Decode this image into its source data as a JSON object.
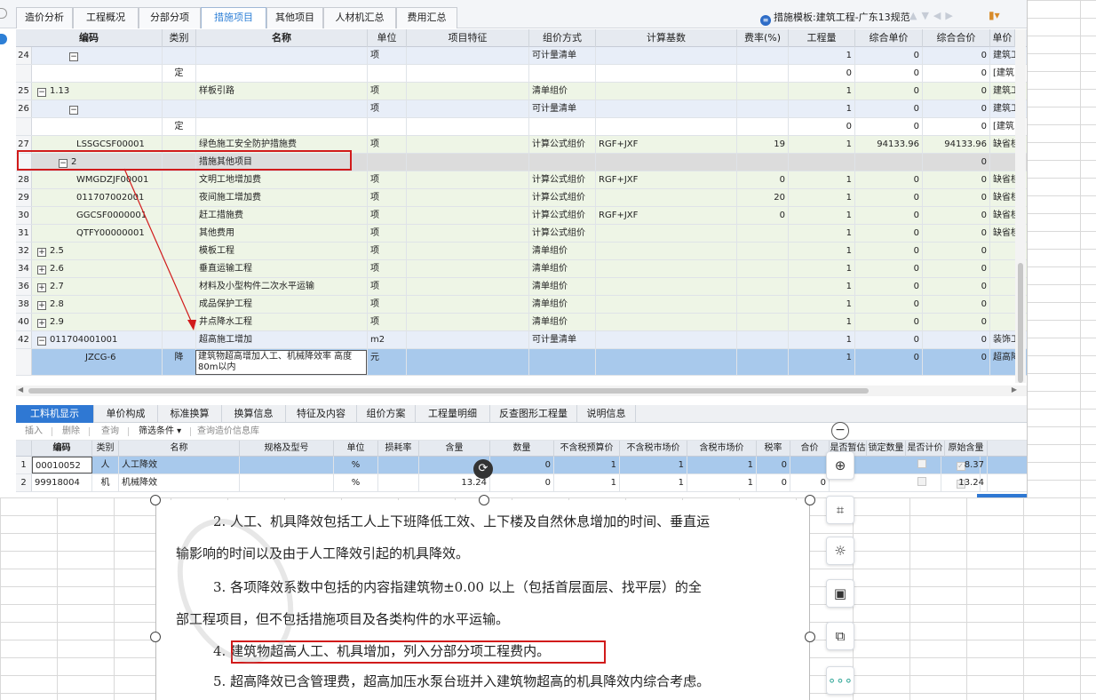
{
  "top_tabs": [
    "造价分析",
    "工程概况",
    "分部分项",
    "措施项目",
    "其他项目",
    "人材机汇总",
    "费用汇总"
  ],
  "active_tab": "措施项目",
  "template_label": "措施模板:建筑工程-广东13规范",
  "grid": {
    "headers": [
      "编码",
      "类别",
      "名称",
      "单位",
      "项目特征",
      "组价方式",
      "计算基数",
      "费率(%)",
      "工程量",
      "综合单价",
      "综合合价",
      "单价"
    ],
    "rows": [
      {
        "num": "24",
        "code": "",
        "tree": "−",
        "cat": "",
        "name": "",
        "unit": "项",
        "method": "可计量清单",
        "base": "",
        "rate": "",
        "qty": "1",
        "uprice": "0",
        "total": "0",
        "extra": "建筑工"
      },
      {
        "num": "",
        "code": "",
        "tree": "",
        "cat": "定",
        "name": "",
        "unit": "",
        "method": "",
        "base": "",
        "rate": "",
        "qty": "0",
        "uprice": "0",
        "total": "0",
        "extra": "[建筑"
      },
      {
        "num": "25",
        "code": "1.13",
        "tree": "−",
        "cat": "",
        "name": "样板引路",
        "unit": "项",
        "method": "清单组价",
        "base": "",
        "rate": "",
        "qty": "1",
        "uprice": "0",
        "total": "0",
        "extra": "建筑工"
      },
      {
        "num": "26",
        "code": "",
        "tree": "−",
        "cat": "",
        "name": "",
        "unit": "项",
        "method": "可计量清单",
        "base": "",
        "rate": "",
        "qty": "1",
        "uprice": "0",
        "total": "0",
        "extra": "建筑工"
      },
      {
        "num": "",
        "code": "",
        "tree": "",
        "cat": "定",
        "name": "",
        "unit": "",
        "method": "",
        "base": "",
        "rate": "",
        "qty": "0",
        "uprice": "0",
        "total": "0",
        "extra": "[建筑"
      },
      {
        "num": "27",
        "code": "LSSGCSF00001",
        "tree": "",
        "cat": "",
        "name": "绿色施工安全防护措施费",
        "unit": "项",
        "method": "计算公式组价",
        "base": "RGF+JXF",
        "rate": "19",
        "qty": "1",
        "uprice": "94133.96",
        "total": "94133.96",
        "extra": "缺省桂"
      },
      {
        "num": "",
        "code": "2",
        "tree": "−",
        "cat": "",
        "name": "措施其他项目",
        "unit": "",
        "method": "",
        "base": "",
        "rate": "",
        "qty": "",
        "uprice": "",
        "total": "0",
        "extra": ""
      },
      {
        "num": "28",
        "code": "WMGDZJF00001",
        "tree": "",
        "cat": "",
        "name": "文明工地增加费",
        "unit": "项",
        "method": "计算公式组价",
        "base": "RGF+JXF",
        "rate": "0",
        "qty": "1",
        "uprice": "0",
        "total": "0",
        "extra": "缺省桂"
      },
      {
        "num": "29",
        "code": "011707002001",
        "tree": "",
        "cat": "",
        "name": "夜间施工增加费",
        "unit": "项",
        "method": "计算公式组价",
        "base": "",
        "rate": "20",
        "qty": "1",
        "uprice": "0",
        "total": "0",
        "extra": "缺省桂"
      },
      {
        "num": "30",
        "code": "GGCSF0000001",
        "tree": "",
        "cat": "",
        "name": "赶工措施费",
        "unit": "项",
        "method": "计算公式组价",
        "base": "RGF+JXF",
        "rate": "0",
        "qty": "1",
        "uprice": "0",
        "total": "0",
        "extra": "缺省桂"
      },
      {
        "num": "31",
        "code": "QTFY00000001",
        "tree": "",
        "cat": "",
        "name": "其他费用",
        "unit": "项",
        "method": "计算公式组价",
        "base": "",
        "rate": "",
        "qty": "1",
        "uprice": "0",
        "total": "0",
        "extra": "缺省桂"
      },
      {
        "num": "32",
        "code": "2.5",
        "tree": "+",
        "cat": "",
        "name": "模板工程",
        "unit": "项",
        "method": "清单组价",
        "base": "",
        "rate": "",
        "qty": "1",
        "uprice": "0",
        "total": "0",
        "extra": ""
      },
      {
        "num": "34",
        "code": "2.6",
        "tree": "+",
        "cat": "",
        "name": "垂直运输工程",
        "unit": "项",
        "method": "清单组价",
        "base": "",
        "rate": "",
        "qty": "1",
        "uprice": "0",
        "total": "0",
        "extra": ""
      },
      {
        "num": "36",
        "code": "2.7",
        "tree": "+",
        "cat": "",
        "name": "材料及小型构件二次水平运输",
        "unit": "项",
        "method": "清单组价",
        "base": "",
        "rate": "",
        "qty": "1",
        "uprice": "0",
        "total": "0",
        "extra": ""
      },
      {
        "num": "38",
        "code": "2.8",
        "tree": "+",
        "cat": "",
        "name": "成品保护工程",
        "unit": "项",
        "method": "清单组价",
        "base": "",
        "rate": "",
        "qty": "1",
        "uprice": "0",
        "total": "0",
        "extra": ""
      },
      {
        "num": "40",
        "code": "2.9",
        "tree": "+",
        "cat": "",
        "name": "井点降水工程",
        "unit": "项",
        "method": "清单组价",
        "base": "",
        "rate": "",
        "qty": "1",
        "uprice": "0",
        "total": "0",
        "extra": ""
      },
      {
        "num": "42",
        "code": "011704001001",
        "tree": "−",
        "cat": "",
        "name": "超高施工增加",
        "unit": "m2",
        "method": "可计量清单",
        "base": "",
        "rate": "",
        "qty": "1",
        "uprice": "0",
        "total": "0",
        "extra": "装饰工"
      },
      {
        "num": "",
        "code": "JZCG-6",
        "tree": "",
        "cat": "降",
        "name": "建筑物超高增加人工、机械降效率 高度80m以内",
        "unit": "元",
        "method": "",
        "base": "",
        "rate": "",
        "qty": "1",
        "uprice": "0",
        "total": "0",
        "extra": "超高降"
      }
    ]
  },
  "bottom_tabs": [
    "工料机显示",
    "单价构成",
    "标准换算",
    "换算信息",
    "特征及内容",
    "组价方案",
    "工程量明细",
    "反查图形工程量",
    "说明信息"
  ],
  "bottom_toolbar": [
    "插入",
    "删除",
    "查询",
    "筛选条件",
    "查询造价信息库"
  ],
  "bottom_headers": [
    "编码",
    "类别",
    "名称",
    "规格及型号",
    "单位",
    "损耗率",
    "含量",
    "数量",
    "不含税预算价",
    "不含税市场价",
    "含税市场价",
    "税率",
    "合价",
    "是否暂估",
    "锁定数量",
    "是否计价",
    "原始含量"
  ],
  "bottom_rows": [
    {
      "num": "1",
      "code": "00010052",
      "cat": "人",
      "name": "人工降效",
      "unit": "%",
      "qty_content": "",
      "qty": "0",
      "p1": "1",
      "p2": "1",
      "p3": "1",
      "tax": "0",
      "total": "",
      "orig": "8.37"
    },
    {
      "num": "2",
      "code": "99918004",
      "cat": "机",
      "name": "机械降效",
      "unit": "%",
      "qty_content": "13.24",
      "qty": "0",
      "p1": "1",
      "p2": "1",
      "p3": "1",
      "tax": "0",
      "total": "0",
      "orig": "13.24"
    }
  ],
  "doc": {
    "p1a": "2. 人工、机具降效包括工人上下班降低工效、上下楼及自然休息增加的时间、垂直运",
    "p1b": "输影响的时间以及由于人工降效引起的机具降效。",
    "p2a": "3. 各项降效系数中包括的内容指建筑物±0.00 以上（包括首层面层、找平层）的全",
    "p2b": "部工程项目，但不包括措施项目及各类构件的水平运输。",
    "p3": "4. 建筑物超高人工、机具增加，列入分部分项工程费内。",
    "p4": "5. 超高降效已含管理费，超高加压水泵台班并入建筑物超高的机具降效内综合考虑。"
  },
  "colors": {
    "accent": "#2f78d3",
    "highlight_red": "#d11b1b",
    "selected_row": "#a8c9ec"
  }
}
